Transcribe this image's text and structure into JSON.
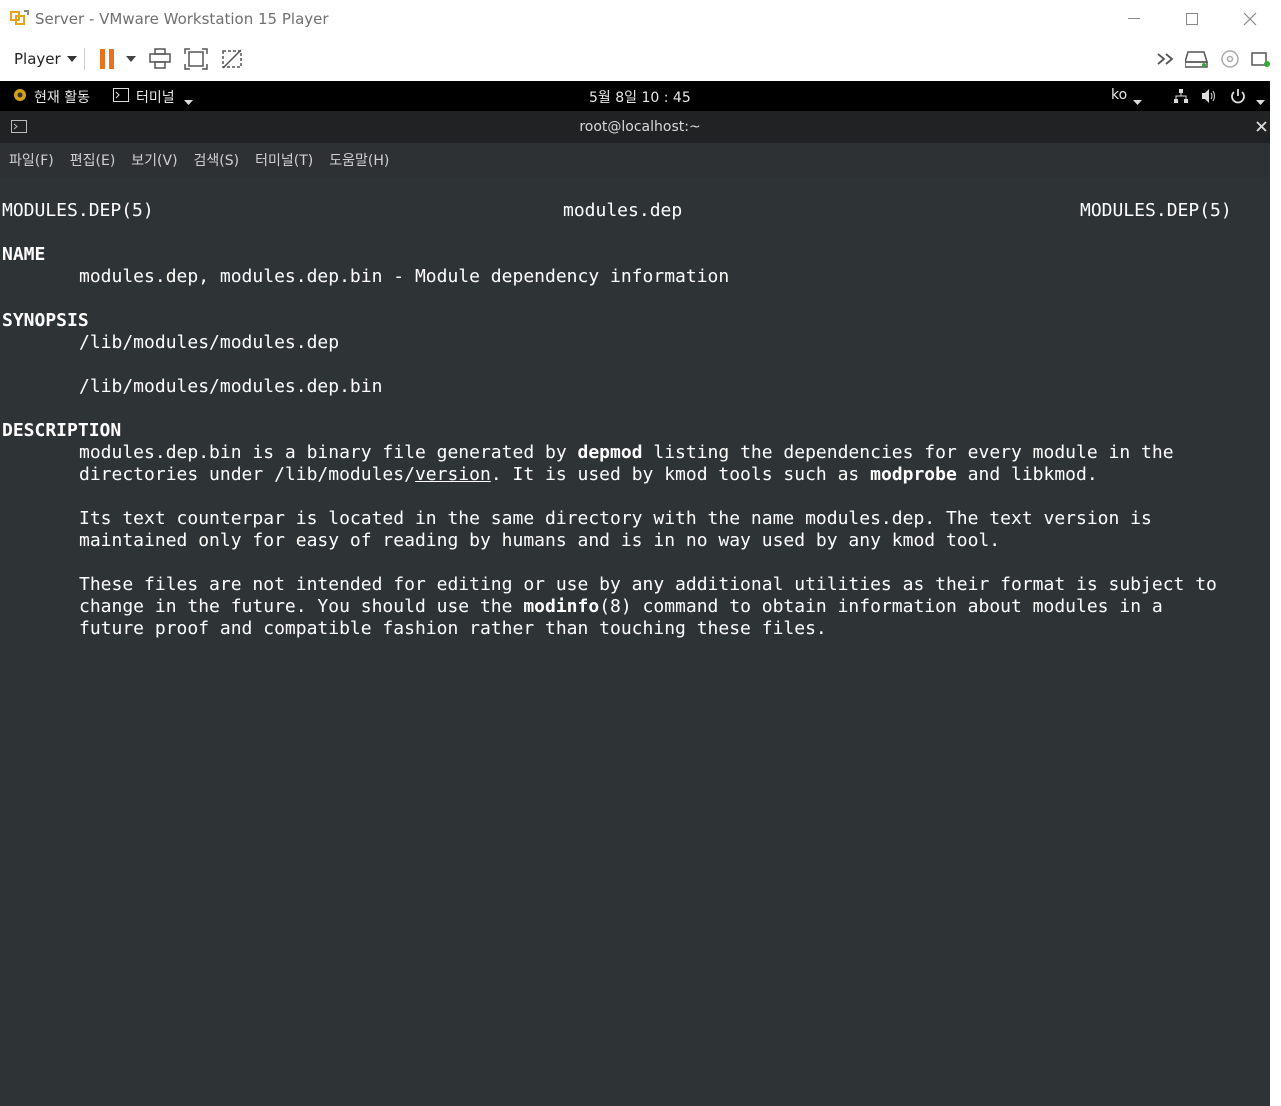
{
  "window": {
    "title": "Server - VMware Workstation 15 Player"
  },
  "toolbar": {
    "player_label": "Player"
  },
  "gnome": {
    "activities": "현재 활동",
    "app": "터미널",
    "clock": "5월 8일 10 : 45",
    "lang": "ko"
  },
  "terminal": {
    "title": "root@localhost:~",
    "menu": [
      "파일(F)",
      "편집(E)",
      "보기(V)",
      "검색(S)",
      "터미널(T)",
      "도움말(H)"
    ],
    "header": {
      "left": "MODULES.DEP(5)",
      "center": "modules.dep",
      "right": "MODULES.DEP(5)"
    },
    "name_heading": "NAME",
    "name_text": "modules.dep, modules.dep.bin - Module dependency information",
    "synopsis_heading": "SYNOPSIS",
    "synopsis_1": "/lib/modules/modules.dep",
    "synopsis_2": "/lib/modules/modules.dep.bin",
    "description_heading": "DESCRIPTION",
    "desc1_a": "modules.dep.bin is a binary file generated by ",
    "desc1_b": "depmod",
    "desc1_c": " listing the dependencies for every module in the",
    "desc2_a": "directories under /lib/modules/",
    "desc2_b": "version",
    "desc2_c": ". It is used by kmod tools such as ",
    "desc2_d": "modprobe",
    "desc2_e": " and libkmod.",
    "desc3": "Its text counterpar is located in the same directory with the name modules.dep. The text version is",
    "desc4": "maintained only for easy of reading by humans and is in no way used by any kmod tool.",
    "desc5": "These files are not intended for editing or use by any additional utilities as their format is subject to",
    "desc6_a": "change in the future. You should use the ",
    "desc6_b": "modinfo",
    "desc6_c": "(8) command to obtain information about modules in a",
    "desc7": "future proof and compatible fashion rather than touching these files."
  }
}
